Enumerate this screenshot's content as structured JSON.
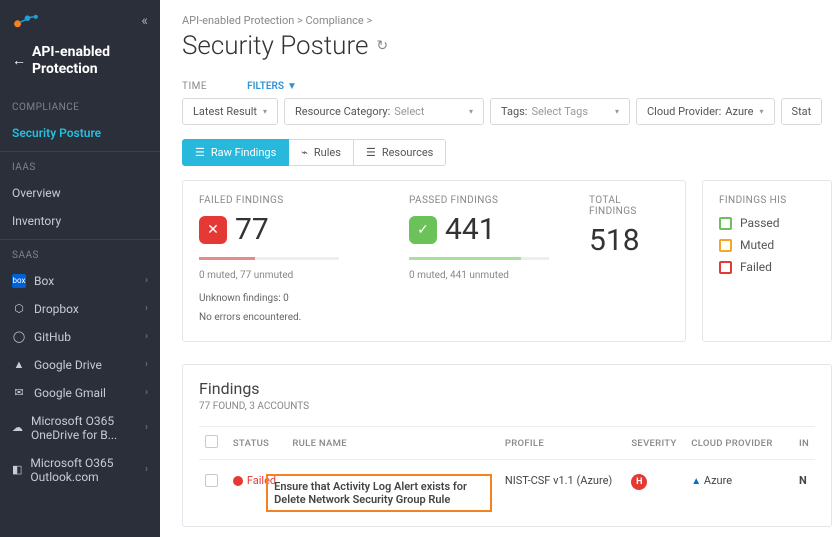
{
  "breadcrumb": "API-enabled Protection > Compliance >",
  "page_title": "Security Posture",
  "sidebar": {
    "back_title": "API-enabled Protection",
    "groups": [
      {
        "label": "COMPLIANCE",
        "items": [
          {
            "label": "Security Posture",
            "active": true
          }
        ]
      },
      {
        "label": "IAAS",
        "items": [
          {
            "label": "Overview"
          },
          {
            "label": "Inventory"
          }
        ]
      },
      {
        "label": "SAAS",
        "items": [
          {
            "label": "Box",
            "icon": "box-icon"
          },
          {
            "label": "Dropbox",
            "icon": "dropbox-icon"
          },
          {
            "label": "GitHub",
            "icon": "github-icon"
          },
          {
            "label": "Google Drive",
            "icon": "gdrive-icon"
          },
          {
            "label": "Google Gmail",
            "icon": "gmail-icon"
          },
          {
            "label": "Microsoft O365 OneDrive for B...",
            "icon": "onedrive-icon"
          },
          {
            "label": "Microsoft O365 Outlook.com",
            "icon": "outlook-icon"
          }
        ]
      }
    ]
  },
  "filters": {
    "time_label": "TIME",
    "filters_label": "FILTERS",
    "time_value": "Latest Result",
    "category_prefix": "Resource Category:",
    "category_value": "Select",
    "tags_prefix": "Tags:",
    "tags_value": "Select Tags",
    "provider_prefix": "Cloud Provider:",
    "provider_value": "Azure",
    "status_prefix": "Stat"
  },
  "toggles": {
    "raw": "Raw Findings",
    "rules": "Rules",
    "resources": "Resources"
  },
  "stats": {
    "failed_label": "FAILED FINDINGS",
    "failed_value": "77",
    "failed_sub": "0 muted, 77 unmuted",
    "passed_label": "PASSED FINDINGS",
    "passed_value": "441",
    "passed_sub": "0 muted, 441 unmuted",
    "total_label": "TOTAL FINDINGS",
    "total_value": "518",
    "unknown": "Unknown findings: 0",
    "errors": "No errors encountered."
  },
  "legend": {
    "title": "FINDINGS HIS",
    "passed": "Passed",
    "muted": "Muted",
    "failed": "Failed"
  },
  "findings": {
    "title": "Findings",
    "subtitle": "77 FOUND, 3 ACCOUNTS",
    "headers": {
      "status": "STATUS",
      "rule": "RULE NAME",
      "profile": "PROFILE",
      "severity": "SEVERITY",
      "provider": "CLOUD PROVIDER",
      "in": "IN"
    },
    "row": {
      "status": "Failed",
      "rule": "Ensure that Activity Log Alert exists for Delete Network Security Group Rule",
      "profile": "NIST-CSF v1.1 (Azure)",
      "severity": "H",
      "provider": "Azure",
      "in": "N"
    }
  }
}
